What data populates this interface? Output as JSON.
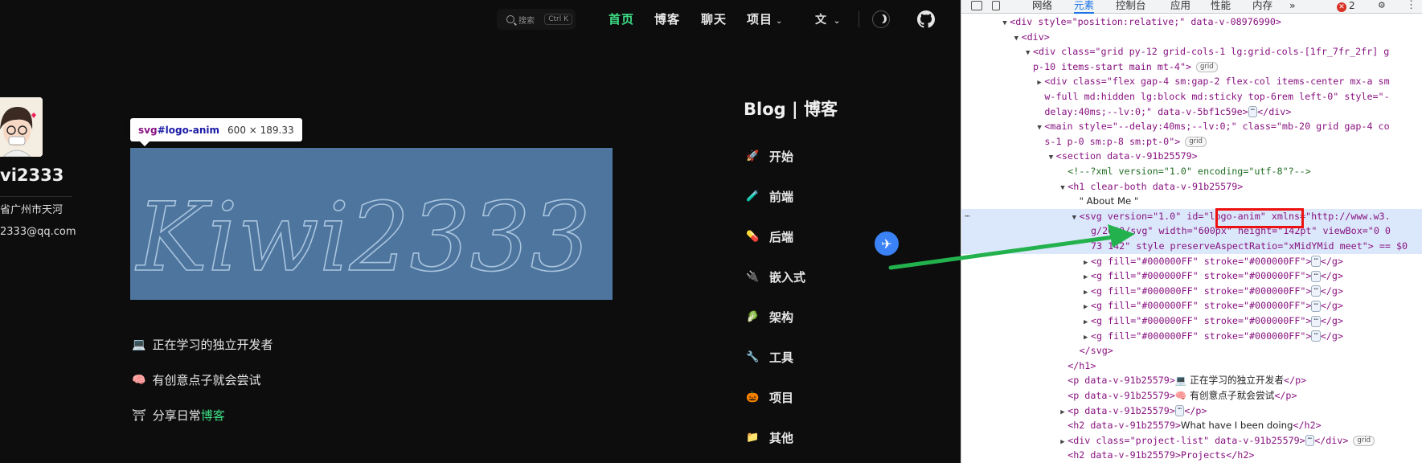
{
  "nav": {
    "search_placeholder": "搜索",
    "search_kbd": "Ctrl K",
    "links": [
      "首页",
      "博客",
      "聊天",
      "项目"
    ],
    "active_index": 0,
    "chevron": "⌄",
    "lang_glyph": "文",
    "colors": {
      "accent": "#3ddc84",
      "text": "#e6e6e6",
      "bg": "#0d0d0d"
    }
  },
  "profile": {
    "name": "vi2333",
    "location": "省广州市天河",
    "email": "2333@qq.com"
  },
  "logo": {
    "tooltip_tag": "svg",
    "tooltip_id": "#logo-anim",
    "tooltip_size": "600 × 189.33",
    "signature": "Kiwi2333",
    "highlight_color": "#5c8cbe"
  },
  "bio": [
    {
      "icon": "laptop-icon",
      "text": "正在学习的独立开发者",
      "link": ""
    },
    {
      "icon": "brain-icon",
      "text": "有创意点子就会尝试",
      "link": ""
    },
    {
      "icon": "shrine-icon",
      "text": "分享日常",
      "link": "博客"
    }
  ],
  "blog_sidebar": {
    "title": "Blog | 博客",
    "items": [
      {
        "label": "开始",
        "icon": "🚀"
      },
      {
        "label": "前端",
        "icon": "🧪"
      },
      {
        "label": "后端",
        "icon": "💊"
      },
      {
        "label": "嵌入式",
        "icon": "🔌"
      },
      {
        "label": "架构",
        "icon": "🥬"
      },
      {
        "label": "工具",
        "icon": "🔧"
      },
      {
        "label": "项目",
        "icon": "🎃"
      },
      {
        "label": "其他",
        "icon": "📁"
      }
    ]
  },
  "fab": {
    "icon": "✈"
  },
  "devtools": {
    "tabs": [
      "网络",
      "元素",
      "控制台",
      "应用",
      "性能",
      "内存",
      "»"
    ],
    "active_tab": 1,
    "error_count": "2",
    "dom_lines": [
      {
        "indent": 6,
        "tog": "▼",
        "html": "<div style=\"position:relative;\" data-v-08976990>"
      },
      {
        "indent": 8,
        "tog": "▼",
        "html": "<div>"
      },
      {
        "indent": 10,
        "tog": "▼",
        "html": "<div class=\"grid py-12 grid-cols-1 lg:grid-cols-[1fr_7fr_2fr] g"
      },
      {
        "indent": 10,
        "tog": "",
        "html": "p-10 items-start main mt-4\">",
        "pill": "grid"
      },
      {
        "indent": 12,
        "tog": "▶",
        "html": "<div class=\"flex gap-4 sm:gap-2 flex-col items-center mx-a sm"
      },
      {
        "indent": 12,
        "tog": "",
        "html": "w-full md:hidden lg:block md:sticky top-6rem left-0\" style=\"-"
      },
      {
        "indent": 12,
        "tog": "",
        "html": "delay:40ms;--lv:0;\" data-v-5bf1c59e>",
        "ell": true,
        "tail": "</div>"
      },
      {
        "indent": 12,
        "tog": "▼",
        "html": "<main style=\"--delay:40ms;--lv:0;\" class=\"mb-20 grid gap-4 co"
      },
      {
        "indent": 12,
        "tog": "",
        "html": "s-1 p-0 sm:p-8 sm:pt-0\">",
        "pill": "grid"
      },
      {
        "indent": 14,
        "tog": "▼",
        "html": "<section data-v-91b25579>"
      },
      {
        "indent": 16,
        "tog": "",
        "html": "<!--?xml version=\"1.0\" encoding=\"utf-8\"?-->",
        "comment": true
      },
      {
        "indent": 16,
        "tog": "▼",
        "html": "<h1 clear-both data-v-91b25579>"
      },
      {
        "indent": 18,
        "tog": "",
        "text": "\" About Me \""
      },
      {
        "indent": 18,
        "tog": "▼",
        "html": "<svg version=\"1.0\" id=\"logo-anim\" xmlns=\"http://www.w3.",
        "selected": true
      },
      {
        "indent": 20,
        "tog": "",
        "html": "g/2000/svg\" width=\"600px\" height=\"142pt\" viewBox=\"0 0",
        "selected": true
      },
      {
        "indent": 20,
        "tog": "",
        "html": "73 142\" style preserveAspectRatio=\"xMidYMid meet\"> == $0",
        "selected": true
      },
      {
        "indent": 20,
        "tog": "▶",
        "html": "<g fill=\"#000000FF\" stroke=\"#000000FF\">",
        "ell": true,
        "tail": "</g>"
      },
      {
        "indent": 20,
        "tog": "▶",
        "html": "<g fill=\"#000000FF\" stroke=\"#000000FF\">",
        "ell": true,
        "tail": "</g>"
      },
      {
        "indent": 20,
        "tog": "▶",
        "html": "<g fill=\"#000000FF\" stroke=\"#000000FF\">",
        "ell": true,
        "tail": "</g>"
      },
      {
        "indent": 20,
        "tog": "▶",
        "html": "<g fill=\"#000000FF\" stroke=\"#000000FF\">",
        "ell": true,
        "tail": "</g>"
      },
      {
        "indent": 20,
        "tog": "▶",
        "html": "<g fill=\"#000000FF\" stroke=\"#000000FF\">",
        "ell": true,
        "tail": "</g>"
      },
      {
        "indent": 20,
        "tog": "▶",
        "html": "<g fill=\"#000000FF\" stroke=\"#000000FF\">",
        "ell": true,
        "tail": "</g>"
      },
      {
        "indent": 18,
        "tog": "",
        "html": "</svg>"
      },
      {
        "indent": 16,
        "tog": "",
        "html": "</h1>"
      },
      {
        "indent": 16,
        "tog": "",
        "html": "<p data-v-91b25579>",
        "text_after": "💻 正在学习的独立开发者",
        "tail": "</p>"
      },
      {
        "indent": 16,
        "tog": "",
        "html": "<p data-v-91b25579>",
        "text_after": "🧠 有创意点子就会尝试",
        "tail": "</p>"
      },
      {
        "indent": 16,
        "tog": "▶",
        "html": "<p data-v-91b25579>",
        "ell": true,
        "tail": "</p>"
      },
      {
        "indent": 16,
        "tog": "",
        "html": "<h2 data-v-91b25579>",
        "text_after": "What have I been doing",
        "tail": "</h2>"
      },
      {
        "indent": 16,
        "tog": "▶",
        "html": "<div class=\"project-list\" data-v-91b25579>",
        "ell": true,
        "tail": "</div>",
        "pill": "grid"
      },
      {
        "indent": 16,
        "tog": "",
        "html": "<h2 data-v-91b25579>Projects</h2>"
      }
    ]
  }
}
